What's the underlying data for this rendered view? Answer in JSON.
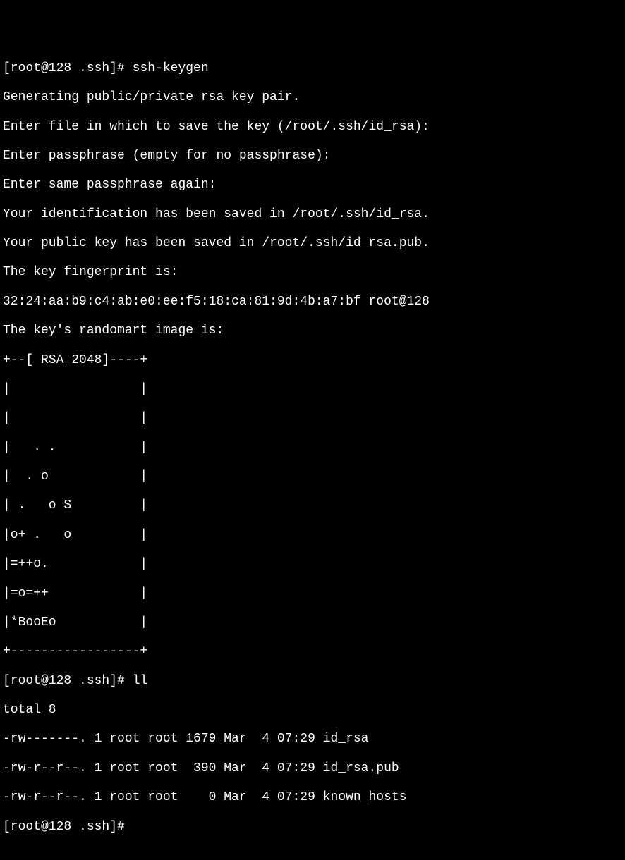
{
  "lines": [
    "[root@128 .ssh]# ssh-keygen",
    "Generating public/private rsa key pair.",
    "Enter file in which to save the key (/root/.ssh/id_rsa):",
    "Enter passphrase (empty for no passphrase):",
    "Enter same passphrase again:",
    "Your identification has been saved in /root/.ssh/id_rsa.",
    "Your public key has been saved in /root/.ssh/id_rsa.pub.",
    "The key fingerprint is:",
    "32:24:aa:b9:c4:ab:e0:ee:f5:18:ca:81:9d:4b:a7:bf root@128",
    "The key's randomart image is:",
    "+--[ RSA 2048]----+",
    "|                 |",
    "|                 |",
    "|   . .           |",
    "|  . o            |",
    "| .   o S         |",
    "|o+ .   o         |",
    "|=++o.            |",
    "|=o=++            |",
    "|*BooEo           |",
    "+-----------------+",
    "[root@128 .ssh]# ll",
    "total 8",
    "-rw-------. 1 root root 1679 Mar  4 07:29 id_rsa",
    "-rw-r--r--. 1 root root  390 Mar  4 07:29 id_rsa.pub",
    "-rw-r--r--. 1 root root    0 Mar  4 07:29 known_hosts",
    "[root@128 .ssh]# "
  ]
}
